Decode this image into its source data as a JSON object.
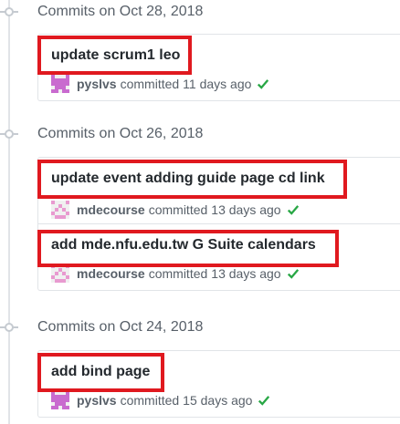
{
  "colors": {
    "highlight": "#e0191f",
    "check": "#28a745",
    "avatar_pyslvs": "#c96bcf",
    "avatar_mdecourse": "#e89ad0"
  },
  "groups": [
    {
      "date_label": "Commits on Oct 28, 2018",
      "commits": [
        {
          "title": "update scrum1 leo",
          "author": "pyslvs",
          "committed": "committed",
          "time": "11 days ago",
          "status_icon": "check-icon",
          "avatar_icon": "identicon-pyslvs"
        }
      ]
    },
    {
      "date_label": "Commits on Oct 26, 2018",
      "commits": [
        {
          "title": "update event adding guide page cd link",
          "author": "mdecourse",
          "committed": "committed",
          "time": "13 days ago",
          "status_icon": "check-icon",
          "avatar_icon": "identicon-mdecourse"
        },
        {
          "title": "add mde.nfu.edu.tw G Suite calendars",
          "author": "mdecourse",
          "committed": "committed",
          "time": "13 days ago",
          "status_icon": "check-icon",
          "avatar_icon": "identicon-mdecourse"
        }
      ]
    },
    {
      "date_label": "Commits on Oct 24, 2018",
      "commits": [
        {
          "title": "add bind page",
          "author": "pyslvs",
          "committed": "committed",
          "time": "15 days ago",
          "status_icon": "check-icon",
          "avatar_icon": "identicon-pyslvs"
        }
      ]
    }
  ]
}
